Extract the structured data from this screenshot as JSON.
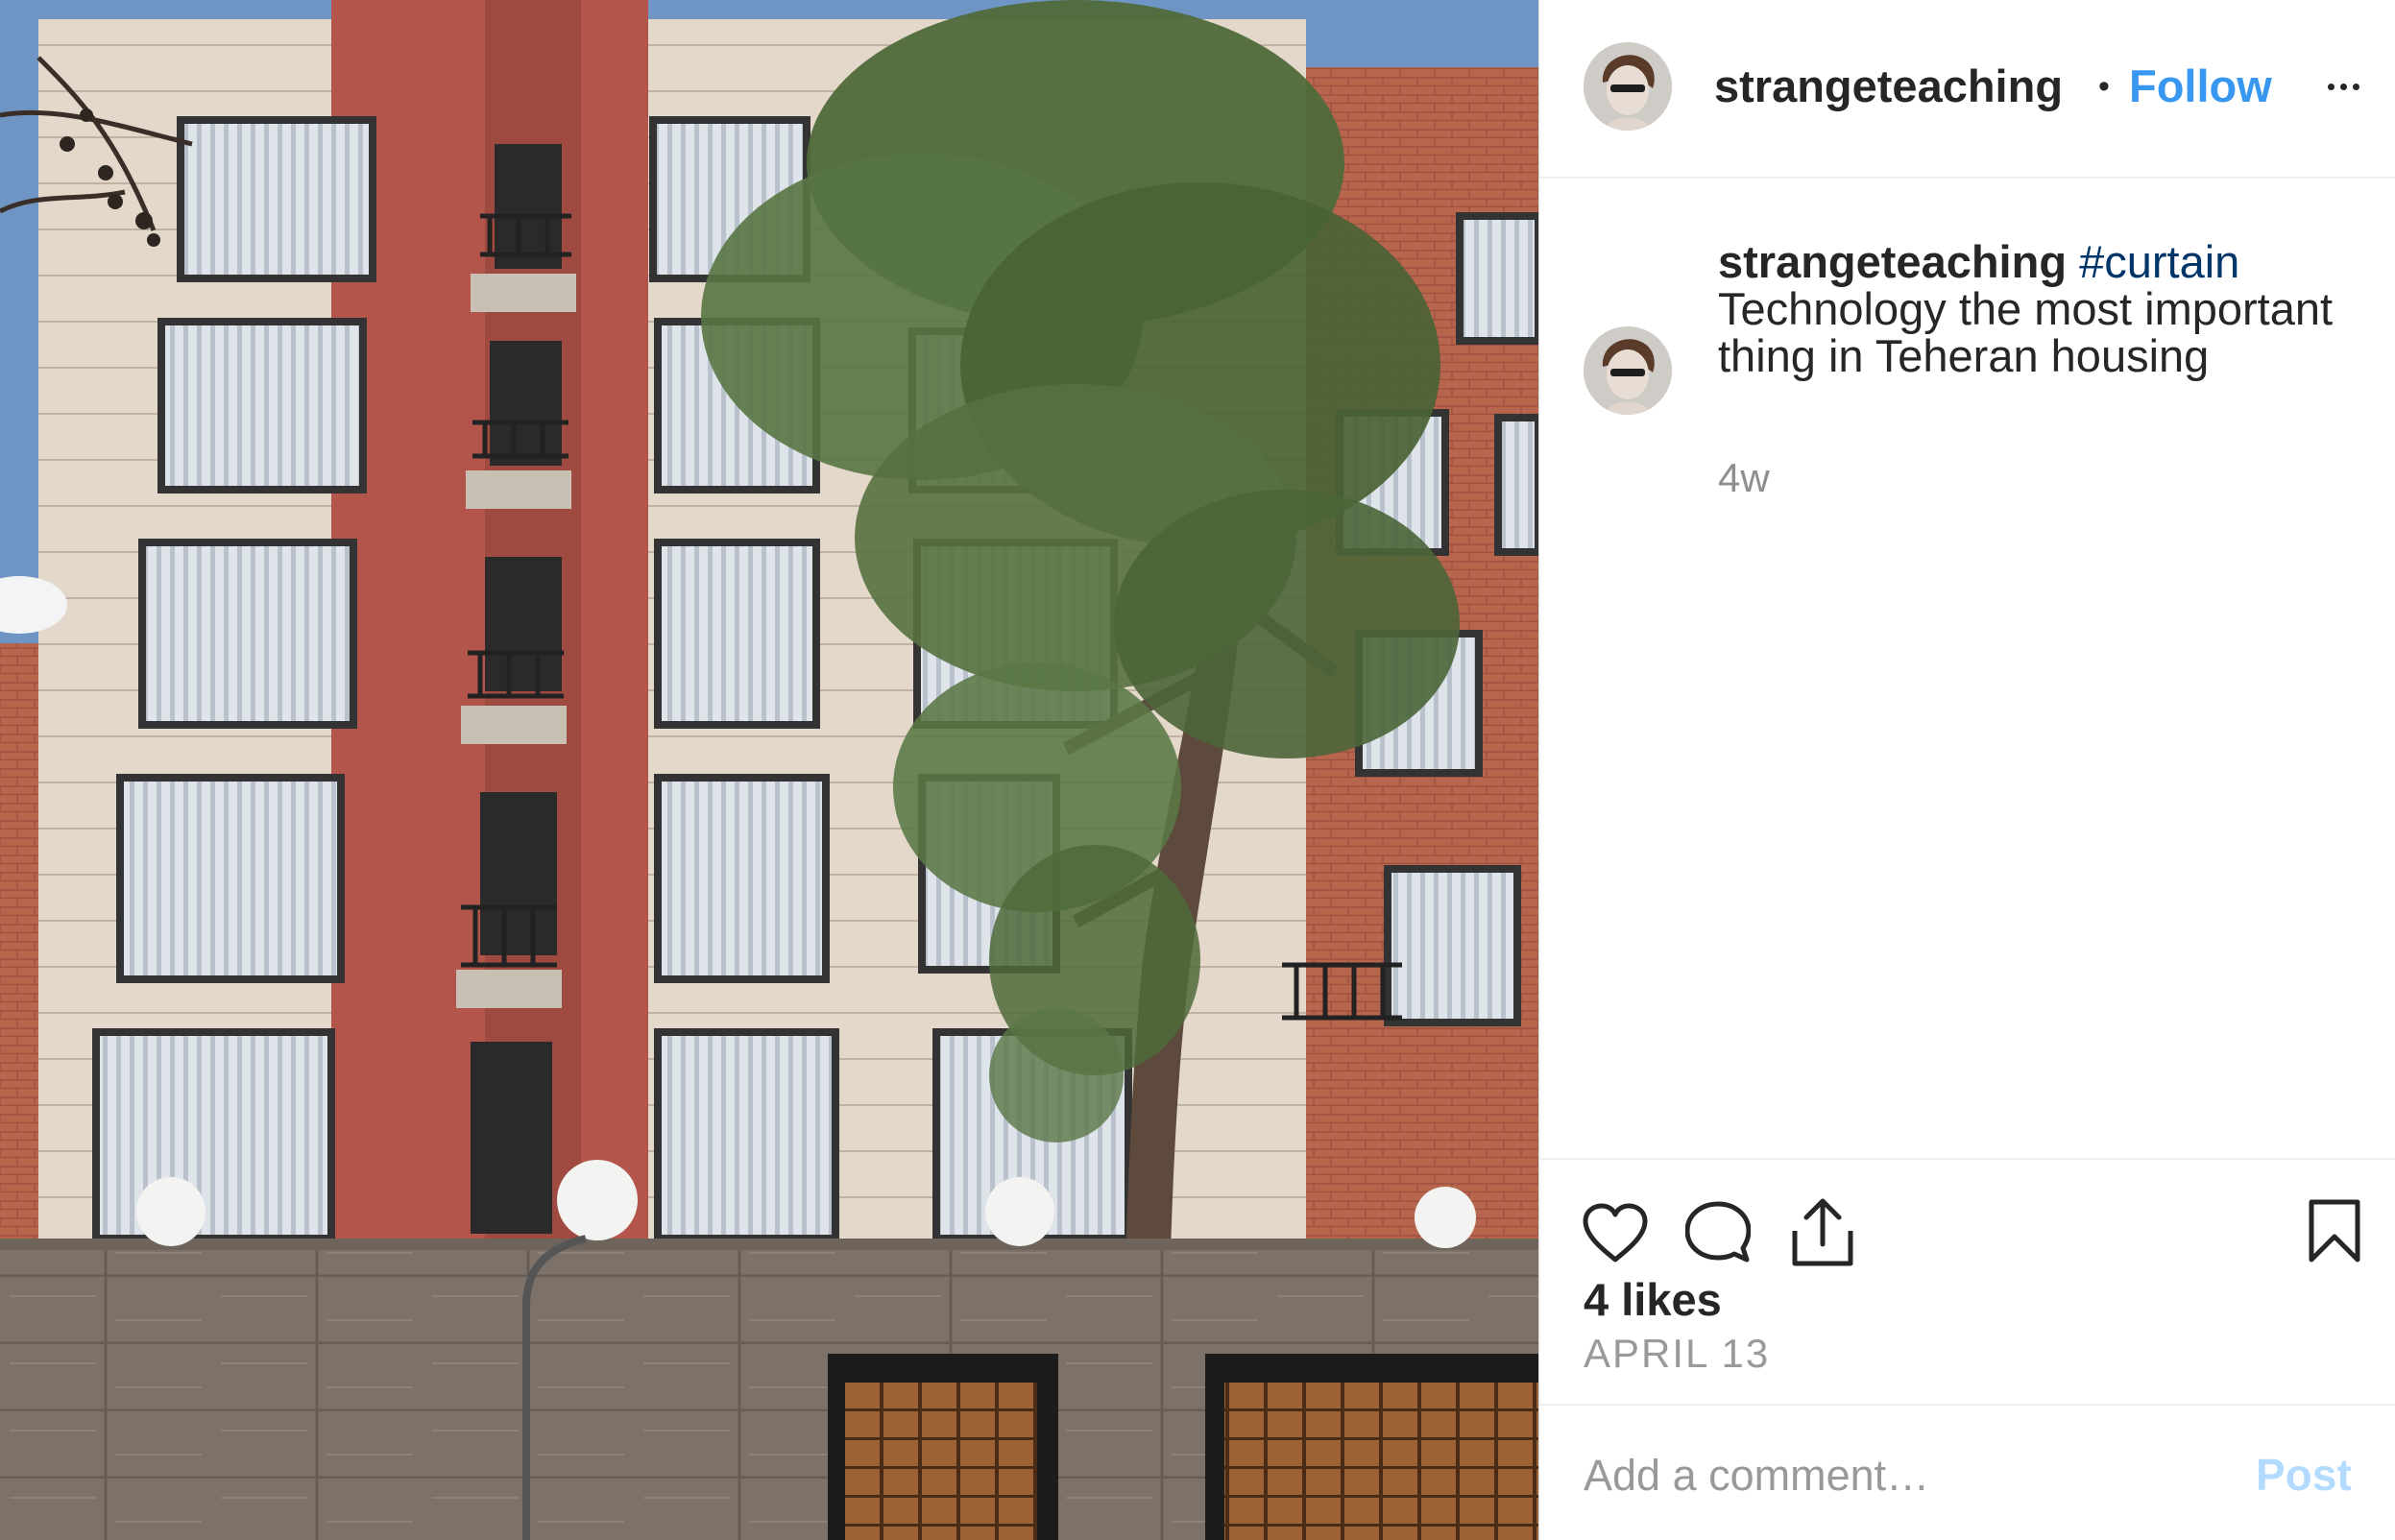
{
  "post": {
    "image_description_icon": "building-photo",
    "header": {
      "username": "strangeteaching",
      "separator": "•",
      "follow_label": "Follow",
      "more_icon": "more-horizontal-icon"
    },
    "caption": {
      "username": "strangeteaching",
      "hashtag": "#curtain",
      "text": "Technology the most important thing in Teheran housing",
      "time_ago": "4w"
    },
    "actions": {
      "like_icon": "heart-icon",
      "comment_icon": "comment-icon",
      "share_icon": "share-icon",
      "save_icon": "bookmark-icon"
    },
    "likes_text": "4 likes",
    "date_text": "APRIL 13",
    "comment": {
      "placeholder": "Add a comment…",
      "post_label": "Post"
    }
  },
  "colors": {
    "link_blue": "#3897f0",
    "hashtag_blue": "#003569",
    "text": "#262626",
    "muted": "#8e8e8e",
    "post_disabled": "#b3dbff"
  }
}
